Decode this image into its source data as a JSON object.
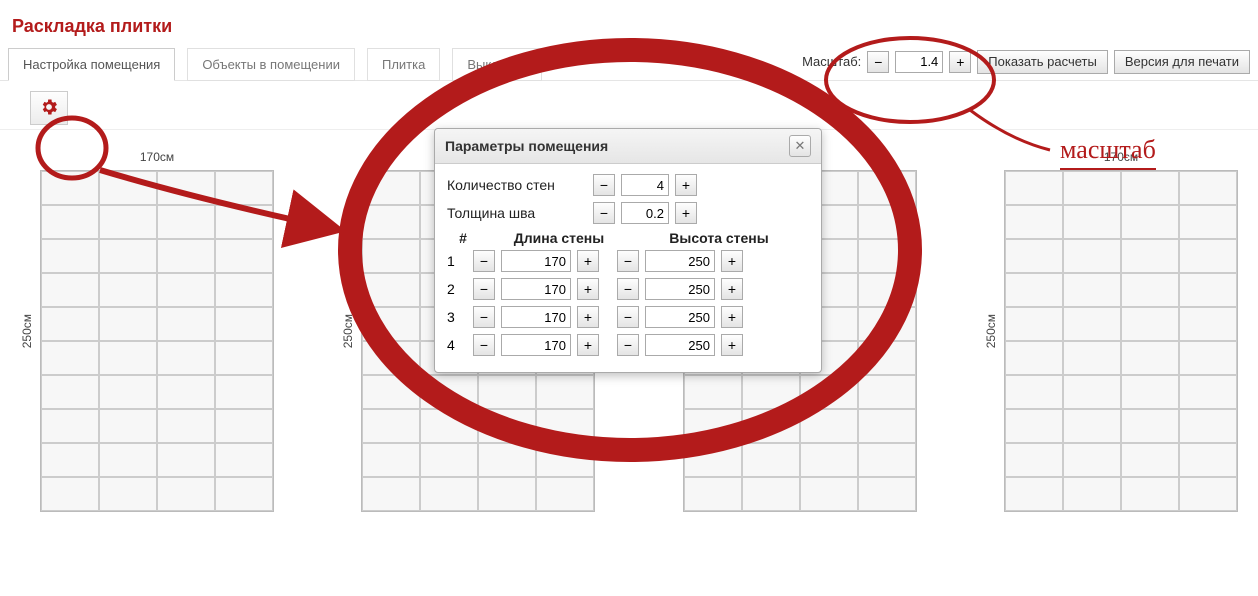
{
  "title": "Раскладка плитки",
  "tabs": [
    "Настройка помещения",
    "Объекты в помещении",
    "Плитка",
    "Выкладка"
  ],
  "scale": {
    "label": "Масштаб:",
    "value": "1.4"
  },
  "buttons": {
    "calc": "Показать расчеты",
    "print": "Версия для печати"
  },
  "walls": {
    "width_label": "170см",
    "height_label": "250см"
  },
  "dialog": {
    "title": "Параметры помещения",
    "wall_count_label": "Количество стен",
    "wall_count": "4",
    "seam_label": "Толщина шва",
    "seam": "0.2",
    "col_num": "#",
    "col_len": "Длина стены",
    "col_h": "Высота стены",
    "rows": [
      {
        "n": "1",
        "len": "170",
        "h": "250"
      },
      {
        "n": "2",
        "len": "170",
        "h": "250"
      },
      {
        "n": "3",
        "len": "170",
        "h": "250"
      },
      {
        "n": "4",
        "len": "170",
        "h": "250"
      }
    ]
  },
  "annotation": {
    "scale_word": "масштаб"
  }
}
